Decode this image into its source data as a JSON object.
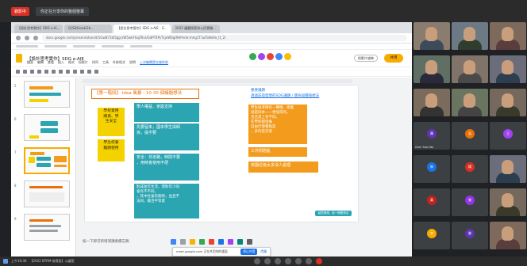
{
  "meeting": {
    "record_badge": "錄影中",
    "share_banner": "你正在分享你的整個螢幕",
    "controls": [
      "mic",
      "camera",
      "captions",
      "present",
      "raise-hand",
      "more",
      "end-call"
    ]
  },
  "browser": {
    "tabs": [
      "【設計思考實作】SDG e-Ai...",
      "(2)SDGs/aki2b...",
      "【設計思考實作】SDG e-AIE - G...",
      "2022 議題探索與公民實踐..."
    ],
    "url": "docs.google.com/presentation/d/1GwB71bl5gg-zW5wkFhqZRvUGdPT4PsTLjeW0giRHPnrbi-mhg1T1wToNdVe_tt_2/"
  },
  "slides": {
    "title": "【設計思考實作】SDG e-AIE",
    "menu": [
      "檔案",
      "編輯",
      "查看",
      "插入",
      "格式",
      "投影片",
      "排列",
      "工具",
      "外掛程式",
      "說明",
      "上次編輯是在幾秒前"
    ],
    "slideshow_label": "投影片放映",
    "share_label": "共用",
    "thumb_numbers": [
      "5",
      "6",
      "7",
      "8",
      "9"
    ],
    "notes_placeholder": "按一下即可新增演講者備忘稿"
  },
  "slide": {
    "header": "【第一階段】 Idea 風暴 - 10-30 個議題想法",
    "blue_note_1": "重要議題",
    "blue_note_2": "透過訪談發現的SDG議題 / 使命與價值想法",
    "yellow_1": "學校資用\n購買、學\n生安全",
    "yellow_2": "學生校餐\n難題使用",
    "teal_1": "學人權益、家庭支持",
    "teal_2": "先要留未，國本學生與師\n資，提不要",
    "teal_3": "安全：非走路，時間不要\n，用時會使用不便",
    "teal_4": "對成長年生活，而對年少同\n會有不不同，\n，其中社會有期待，並且不\n法同，最且平等意",
    "orange_1": "學生與老師有一種樣，感覺\n就是同本一一更值得的，\n活尤其上有不同，\n在學校都發展\n自由行使看點是\n，多的是否發",
    "orange_2": "工作問題亂",
    "orange_3": "校園垃圾太多沒人處理",
    "pill": "創意發想，從一問題想法"
  },
  "participants": [
    {
      "name": "",
      "kind": "video",
      "initial": ""
    },
    {
      "name": "",
      "kind": "video",
      "initial": ""
    },
    {
      "name": "",
      "kind": "video",
      "initial": ""
    },
    {
      "name": "",
      "kind": "video",
      "initial": ""
    },
    {
      "name": "",
      "kind": "video",
      "initial": ""
    },
    {
      "name": "",
      "kind": "video",
      "initial": ""
    },
    {
      "name": "",
      "kind": "video",
      "initial": ""
    },
    {
      "name": "",
      "kind": "video",
      "initial": ""
    },
    {
      "name": "",
      "kind": "video",
      "initial": ""
    },
    {
      "name": "Chen Yuan Yao",
      "kind": "avatar",
      "initial": "陳"
    },
    {
      "name": "",
      "kind": "avatar",
      "initial": "吳"
    },
    {
      "name": "",
      "kind": "avatar",
      "initial": "王"
    },
    {
      "name": "",
      "kind": "avatar",
      "initial": "林"
    },
    {
      "name": "",
      "kind": "avatar",
      "initial": "楊"
    },
    {
      "name": "",
      "kind": "video",
      "initial": ""
    },
    {
      "name": "",
      "kind": "avatar",
      "initial": "黃"
    },
    {
      "name": "",
      "kind": "avatar",
      "initial": "張"
    },
    {
      "name": "",
      "kind": "video",
      "initial": ""
    },
    {
      "name": "",
      "kind": "avatar",
      "initial": "李"
    },
    {
      "name": "",
      "kind": "avatar",
      "initial": "劉"
    },
    {
      "name": "",
      "kind": "video",
      "initial": ""
    }
  ],
  "share_popup": {
    "text": "meet.google.com 正在共用你的畫面",
    "stop_label": "停止共用",
    "hide_label": "隱藏"
  },
  "taskbar": {
    "time": "上午10:36",
    "meeting_label": "【2022 BTRM 前導班】公議室"
  },
  "colors": {
    "teal": "#2ca5b2",
    "yellow": "#f4d200",
    "orange": "#f29b1d",
    "share_yellow": "#f9ab00",
    "record_red": "#d93025"
  }
}
